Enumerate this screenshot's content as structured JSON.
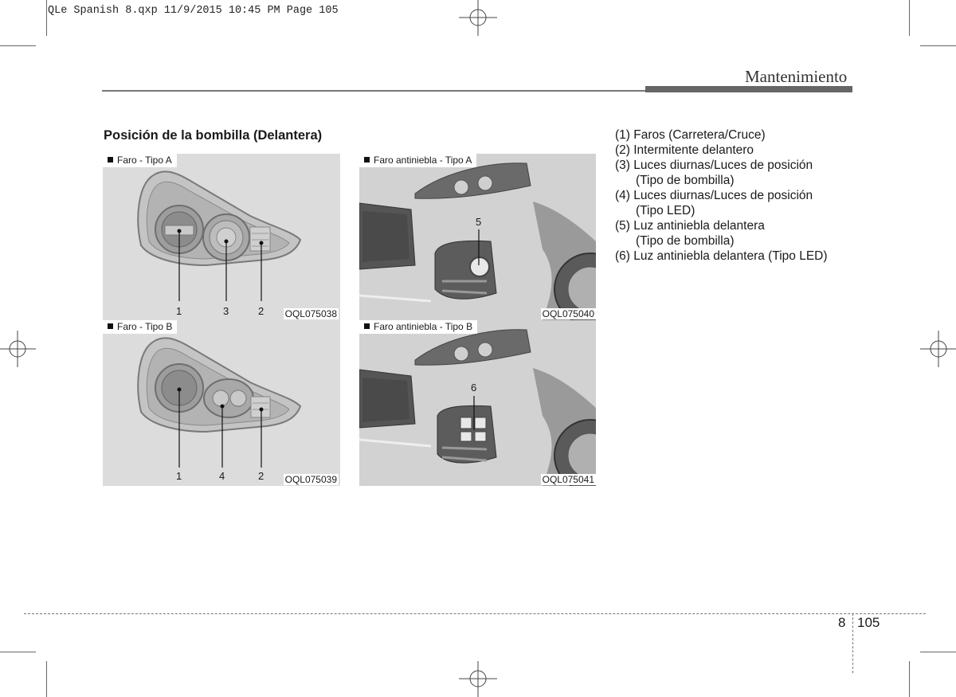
{
  "print_header": "QLe Spanish 8.qxp  11/9/2015  10:45 PM  Page 105",
  "section_title": "Mantenimiento",
  "heading": "Posición de la bombilla (Delantera)",
  "panels": {
    "faro_a": {
      "label": "Faro - Tipo A",
      "code": "OQL075038",
      "callouts": [
        "1",
        "3",
        "2"
      ]
    },
    "faro_b": {
      "label": "Faro - Tipo B",
      "code": "OQL075039",
      "callouts": [
        "1",
        "4",
        "2"
      ]
    },
    "fog_a": {
      "label": "Faro antiniebla - Tipo A",
      "code": "OQL075040",
      "callouts": [
        "5"
      ]
    },
    "fog_b": {
      "label": "Faro antiniebla - Tipo B",
      "code": "OQL075041",
      "callouts": [
        "6"
      ]
    }
  },
  "legend": [
    "(1) Faros (Carretera/Cruce)",
    "(2) Intermitente delantero",
    "(3) Luces diurnas/Luces de posición",
    "(Tipo de bombilla)",
    "(4) Luces diurnas/Luces de posición",
    "(Tipo LED)",
    "(5) Luz antiniebla delantera",
    "(Tipo de bombilla)",
    "(6) Luz antiniebla delantera (Tipo LED)"
  ],
  "footer": {
    "chapter": "8",
    "page": "105"
  }
}
